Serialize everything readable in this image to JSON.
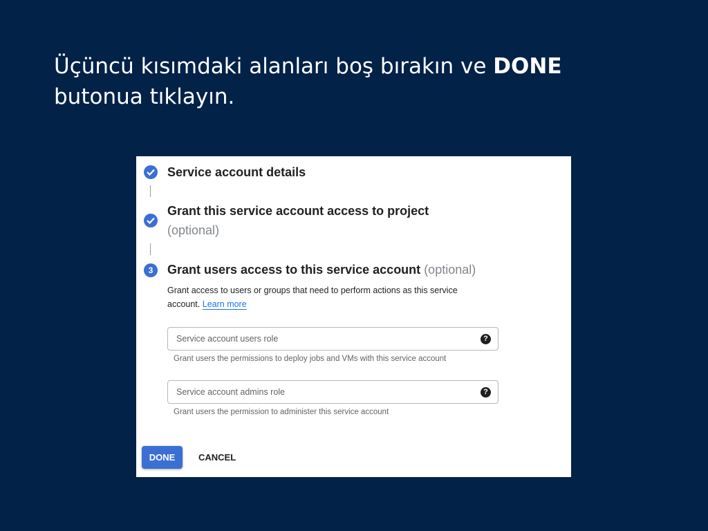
{
  "instruction": {
    "line_part1": "Üçüncü kısımdaki alanları boş bırakın ve ",
    "emphasis": "DONE",
    "line_part2": "butonua tıklayın."
  },
  "steps": [
    {
      "status": "completed",
      "title": "Service account details"
    },
    {
      "status": "completed",
      "title": "Grant this service account access to project",
      "optional": "(optional)"
    },
    {
      "status": "current",
      "number": "3",
      "title": "Grant users access to this service account",
      "optional": "(optional)"
    }
  ],
  "step3": {
    "description": "Grant access to users or groups that need to perform actions as this service account.",
    "learn_more": "Learn more",
    "fields": [
      {
        "placeholder": "Service account users role",
        "hint": "Grant users the permissions to deploy jobs and VMs with this service account"
      },
      {
        "placeholder": "Service account admins role",
        "hint": "Grant users the permission to administer this service account"
      }
    ]
  },
  "actions": {
    "done_label": "DONE",
    "cancel_label": "CANCEL"
  },
  "colors": {
    "background": "#022248",
    "accent": "#3b6fd4",
    "link": "#1a73e8"
  },
  "icons": {
    "completed": "check-circle-icon",
    "help": "help-circle-icon"
  }
}
